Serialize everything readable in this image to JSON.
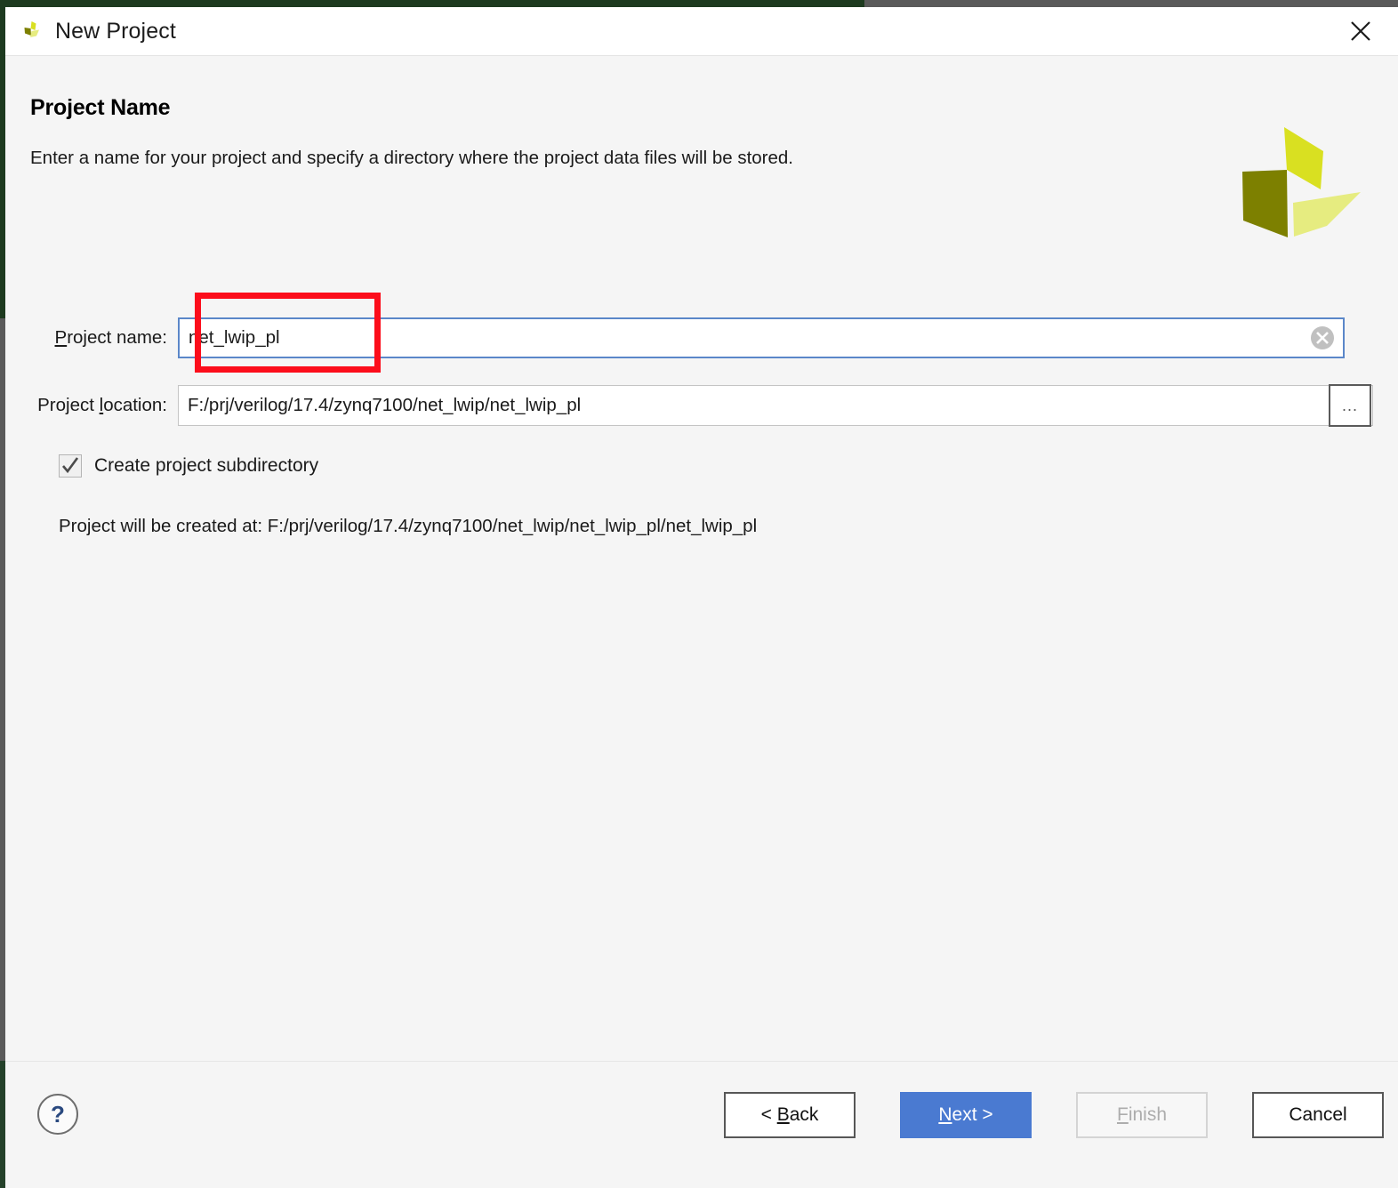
{
  "window": {
    "title": "New Project",
    "icon": "vivado-logo-icon",
    "close_icon": "close-icon"
  },
  "page": {
    "title": "Project Name",
    "subtitle": "Enter a name for your project and specify a directory where the project data files will be stored.",
    "brand_logo": "vivado-logo"
  },
  "form": {
    "project_name": {
      "label_prefix": "P",
      "label_rest": "roject name:",
      "value": "net_lwip_pl",
      "clear_icon": "clear-circle-icon"
    },
    "project_location": {
      "label_prefix": "Project ",
      "label_accel": "l",
      "label_rest": "ocation:",
      "value": "F:/prj/verilog/17.4/zynq7100/net_lwip/net_lwip_pl",
      "clear_icon": "clear-circle-icon",
      "browse_label": "...",
      "browse_icon": "ellipsis-icon"
    },
    "create_subdirectory": {
      "label": "Create project subdirectory",
      "checked": true,
      "check_icon": "checkmark-icon"
    },
    "created_at_text": "Project will be created at: F:/prj/verilog/17.4/zynq7100/net_lwip/net_lwip_pl/net_lwip_pl"
  },
  "footer": {
    "help_label": "?",
    "help_icon": "question-mark-icon",
    "buttons": {
      "back": {
        "prefix": "< ",
        "accel": "B",
        "rest": "ack",
        "state": "enabled"
      },
      "next": {
        "accel": "N",
        "rest": "ext >",
        "state": "primary"
      },
      "finish": {
        "accel": "F",
        "rest": "inish",
        "state": "disabled"
      },
      "cancel": {
        "label": "Cancel",
        "state": "enabled"
      }
    }
  },
  "annotation": {
    "color": "#fc0d1b",
    "target": "project-name-input"
  },
  "colors": {
    "primary_button": "#4a7ad1",
    "input_focus_border": "#5b87c9",
    "dialog_background": "#f5f5f5",
    "titlebar_background": "#ffffff",
    "logo_dark": "#7d8000",
    "logo_mid": "#d9e021",
    "logo_light": "#e6ec80"
  }
}
